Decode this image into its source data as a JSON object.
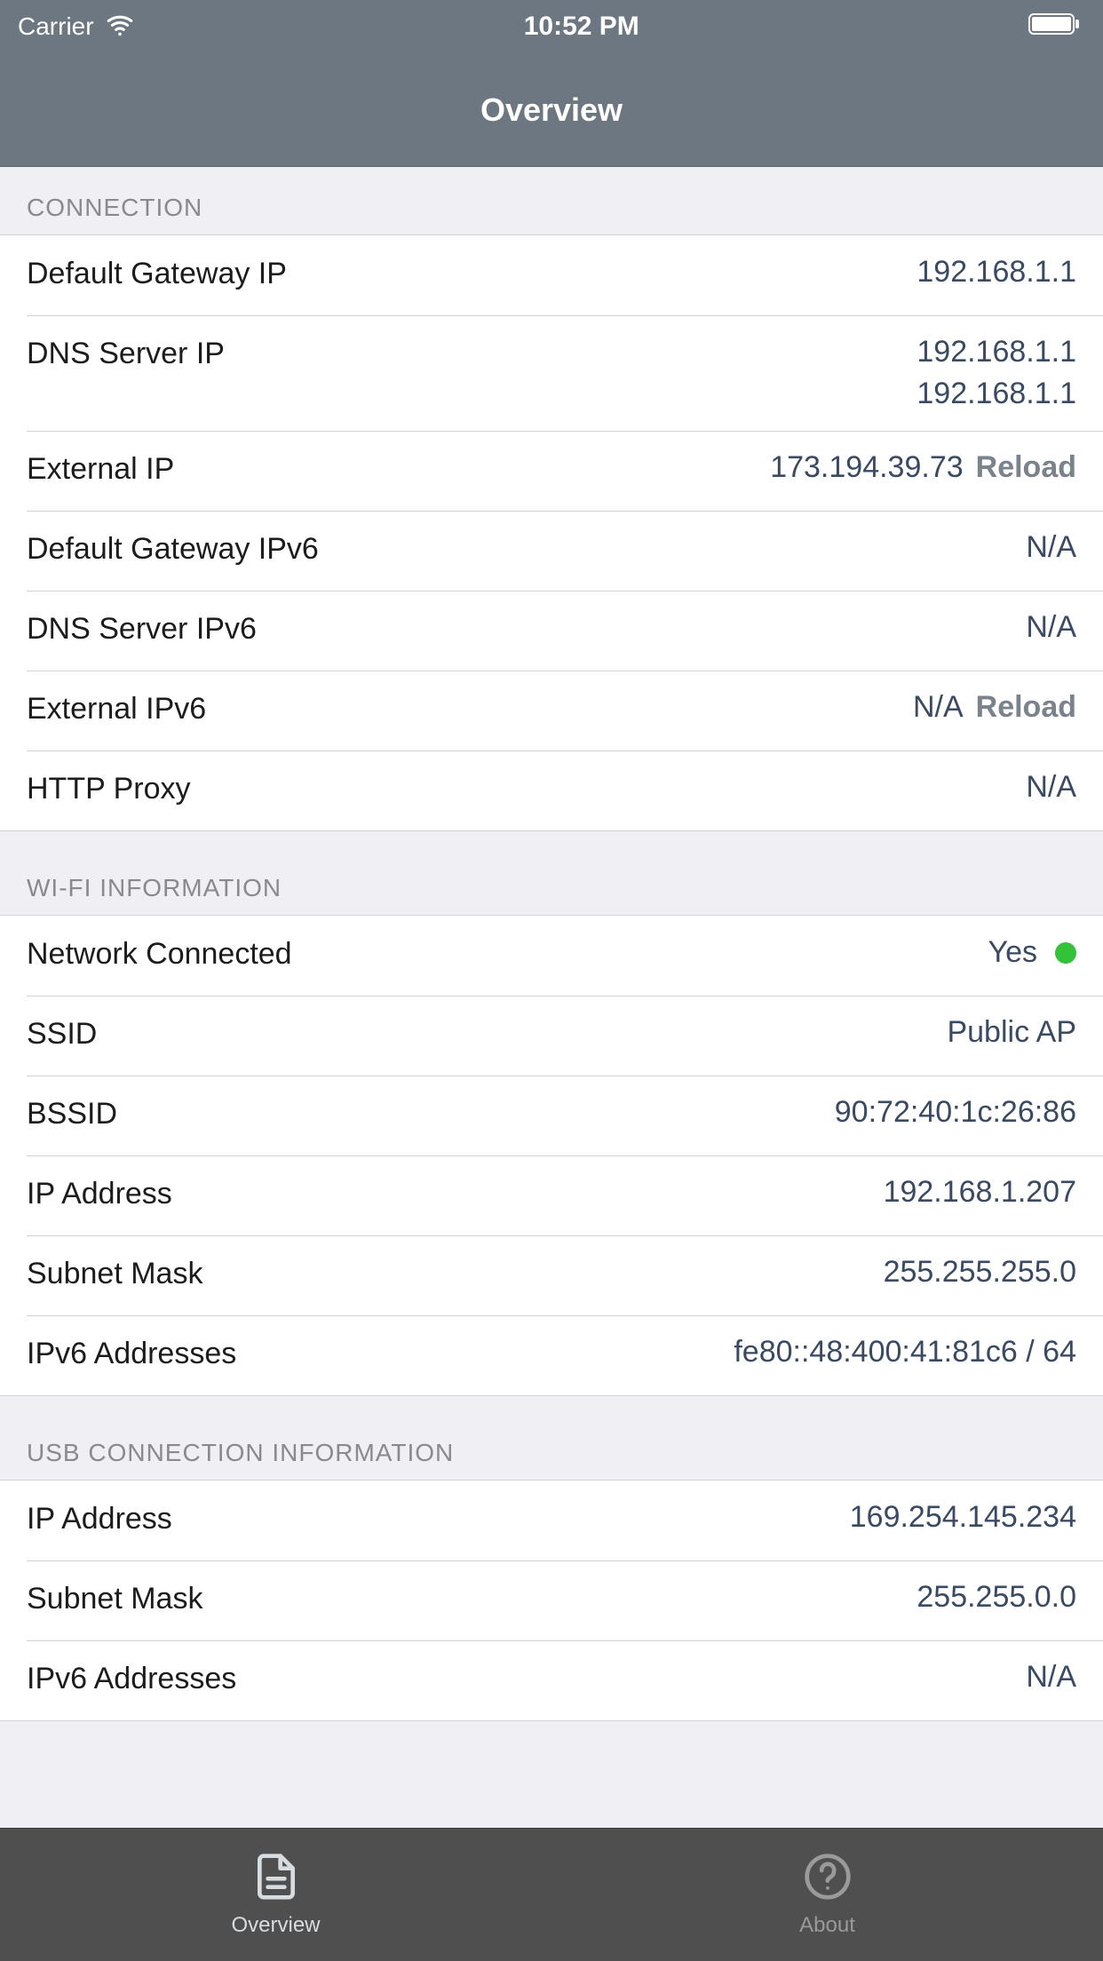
{
  "status_bar": {
    "carrier": "Carrier",
    "time": "10:52 PM"
  },
  "nav": {
    "title": "Overview"
  },
  "sections": {
    "connection": {
      "header": "CONNECTION",
      "rows": {
        "default_gateway_ip": {
          "label": "Default Gateway IP",
          "value": "192.168.1.1"
        },
        "dns_server_ip": {
          "label": "DNS Server IP",
          "value1": "192.168.1.1",
          "value2": "192.168.1.1"
        },
        "external_ip": {
          "label": "External IP",
          "value": "173.194.39.73",
          "action": "Reload"
        },
        "default_gateway_ipv6": {
          "label": "Default Gateway IPv6",
          "value": "N/A"
        },
        "dns_server_ipv6": {
          "label": "DNS Server IPv6",
          "value": "N/A"
        },
        "external_ipv6": {
          "label": "External IPv6",
          "value": "N/A",
          "action": "Reload"
        },
        "http_proxy": {
          "label": "HTTP Proxy",
          "value": "N/A"
        }
      }
    },
    "wifi": {
      "header": "WI-FI INFORMATION",
      "rows": {
        "network_connected": {
          "label": "Network Connected",
          "value": "Yes"
        },
        "ssid": {
          "label": "SSID",
          "value": "Public AP"
        },
        "bssid": {
          "label": "BSSID",
          "value": "90:72:40:1c:26:86"
        },
        "ip_address": {
          "label": "IP Address",
          "value": "192.168.1.207"
        },
        "subnet_mask": {
          "label": "Subnet Mask",
          "value": "255.255.255.0"
        },
        "ipv6_addresses": {
          "label": "IPv6 Addresses",
          "value": "fe80::48:400:41:81c6 / 64"
        }
      }
    },
    "usb": {
      "header": "USB CONNECTION INFORMATION",
      "rows": {
        "ip_address": {
          "label": "IP Address",
          "value": "169.254.145.234"
        },
        "subnet_mask": {
          "label": "Subnet Mask",
          "value": "255.255.0.0"
        },
        "ipv6_addresses": {
          "label": "IPv6 Addresses",
          "value": "N/A"
        }
      }
    }
  },
  "tabs": {
    "overview": "Overview",
    "about": "About"
  }
}
